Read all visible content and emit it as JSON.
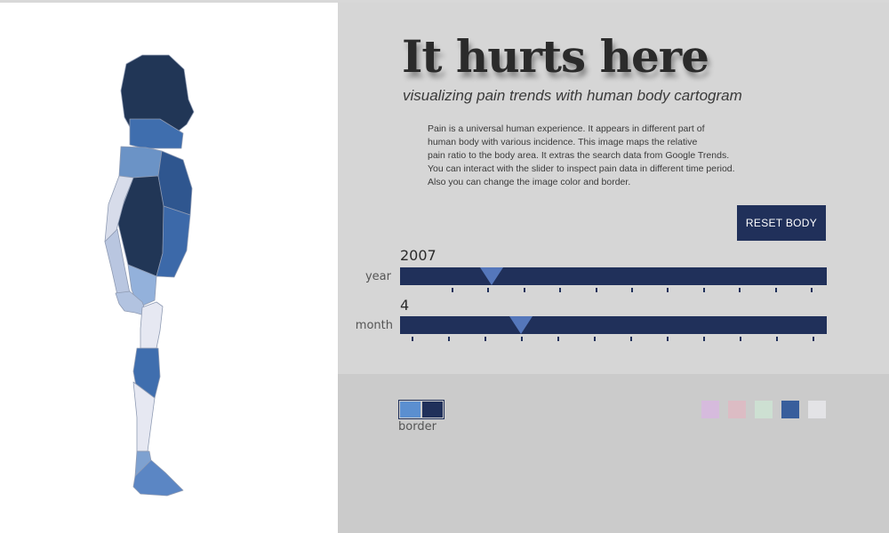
{
  "header": {
    "title": "It hurts here",
    "subtitle": "visualizing pain trends with human body cartogram"
  },
  "description": [
    "Pain is a universal human experience. It appears in different part of",
    "human body with various incidence. This image maps the relative",
    "pain ratio to the body area. It extras the search data from Google Trends.",
    "You can interact with the slider to inspect pain data in different time period.",
    "Also you can change the image color and border."
  ],
  "controls": {
    "reset_label": "RESET BODY",
    "year": {
      "label": "year",
      "value": "2007",
      "tick_count": 11
    },
    "month": {
      "label": "month",
      "value": "4",
      "tick_count": 12
    },
    "border_label": "border"
  },
  "colors": {
    "accent": "#20305a",
    "thumb": "#5577bb",
    "border_toggle": [
      "#5b8fd0",
      "#20305a"
    ],
    "palette": [
      "#d6bbdd",
      "#dcbcc4",
      "#cde0d2",
      "#385e9c",
      "#e3e3e6"
    ]
  }
}
